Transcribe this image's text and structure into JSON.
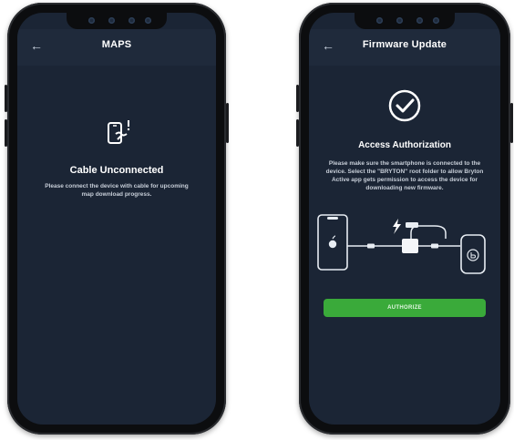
{
  "left_phone": {
    "header": {
      "back_icon": "arrow-left-icon",
      "title": "MAPS"
    },
    "status_icon": "phone-cable-alert-icon",
    "heading": "Cable Unconnected",
    "message_lines": [
      "Please connect the device with cable for upcoming",
      "map download progress."
    ]
  },
  "right_phone": {
    "header": {
      "back_icon": "arrow-left-icon",
      "title": "Firmware Update"
    },
    "status_icon": "check-circle-icon",
    "heading": "Access Authorization",
    "message_lines": [
      "Please make sure the smartphone is connected to the",
      "device. Select the \"BRYTON\" root folder to allow Bryton",
      "Active app gets permission to access the device for",
      "downloading new firmware."
    ],
    "illustration": {
      "bolt_icon": "lightning-icon",
      "phone_logo": "apple-icon",
      "device_logo": "bryton-logo-icon"
    },
    "authorize_button": "AUTHORIZE"
  },
  "colors": {
    "screen_bg": "#1b2535",
    "header_bg": "#1f2a3b",
    "accent_green": "#3aaa3a"
  }
}
